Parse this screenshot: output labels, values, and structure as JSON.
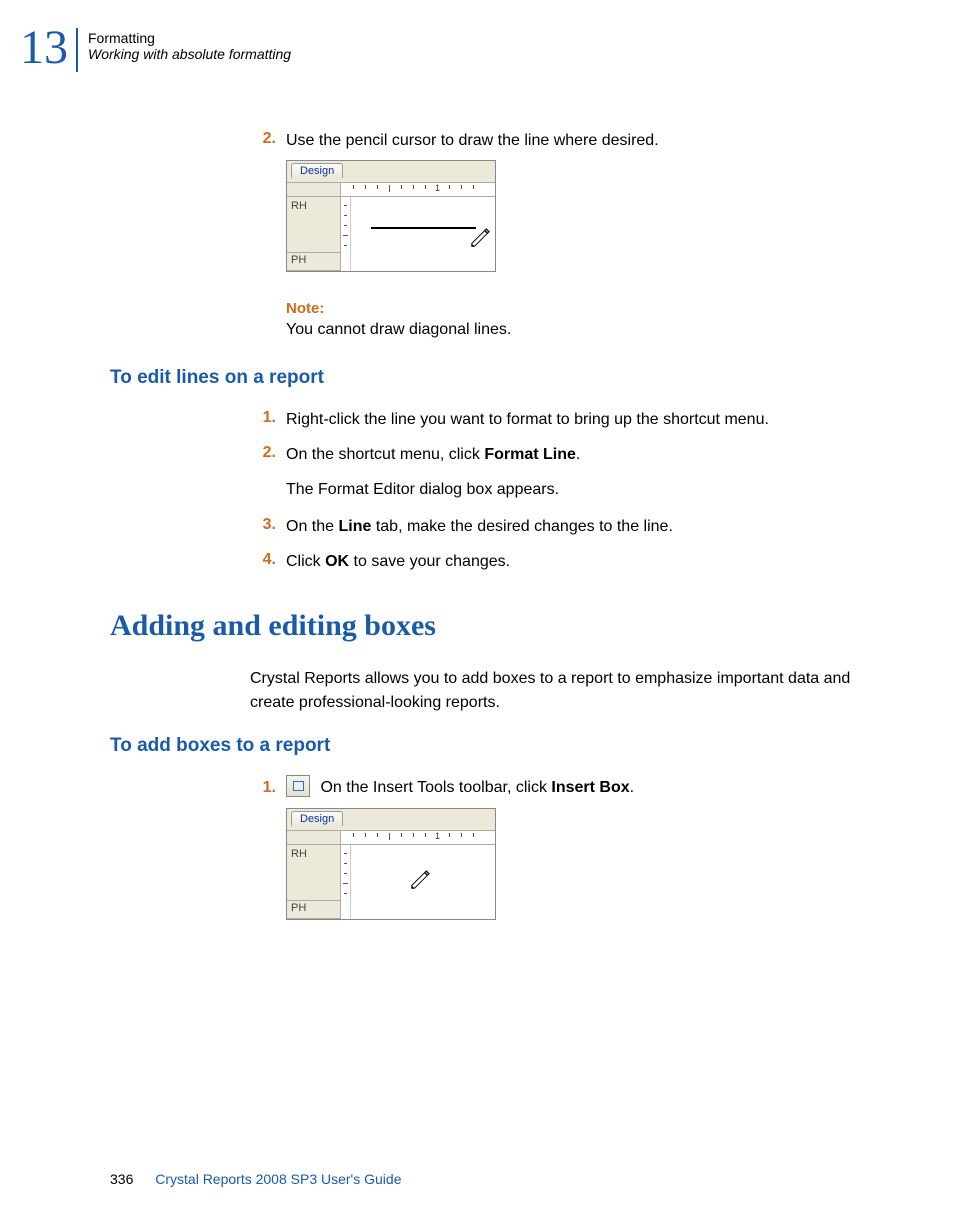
{
  "chapter": {
    "number": "13",
    "title": "Formatting",
    "subtitle": "Working with absolute formatting"
  },
  "section1": {
    "step2_num": "2.",
    "step2_text": "Use the pencil cursor to draw the line where desired."
  },
  "design_panel": {
    "tab": "Design",
    "row_rh": "RH",
    "row_ph": "PH",
    "ruler_1": "1"
  },
  "note": {
    "label": "Note:",
    "text": "You cannot draw diagonal lines."
  },
  "edit_lines": {
    "heading": "To edit lines on a report",
    "steps": [
      {
        "num": "1.",
        "text_before": "Right-click the line you want to format to bring up the shortcut menu."
      },
      {
        "num": "2.",
        "text_before": "On the shortcut menu, click ",
        "bold": "Format Line",
        "text_after": "."
      },
      {
        "sub": "The Format Editor dialog box appears."
      },
      {
        "num": "3.",
        "text_before": "On the ",
        "bold": "Line",
        "text_after": " tab, make the desired changes to the line."
      },
      {
        "num": "4.",
        "text_before": "Click ",
        "bold": "OK",
        "text_after": " to save your changes."
      }
    ]
  },
  "adding_boxes": {
    "heading": "Adding and editing boxes",
    "para": "Crystal Reports allows you to add boxes to a report to emphasize important data and create professional-looking reports."
  },
  "add_boxes": {
    "heading": "To add boxes to a report",
    "step1_num": "1.",
    "step1_text_before": "On the Insert Tools toolbar, click ",
    "step1_bold": "Insert Box",
    "step1_text_after": "."
  },
  "footer": {
    "page": "336",
    "title": "Crystal Reports 2008 SP3 User's Guide"
  }
}
